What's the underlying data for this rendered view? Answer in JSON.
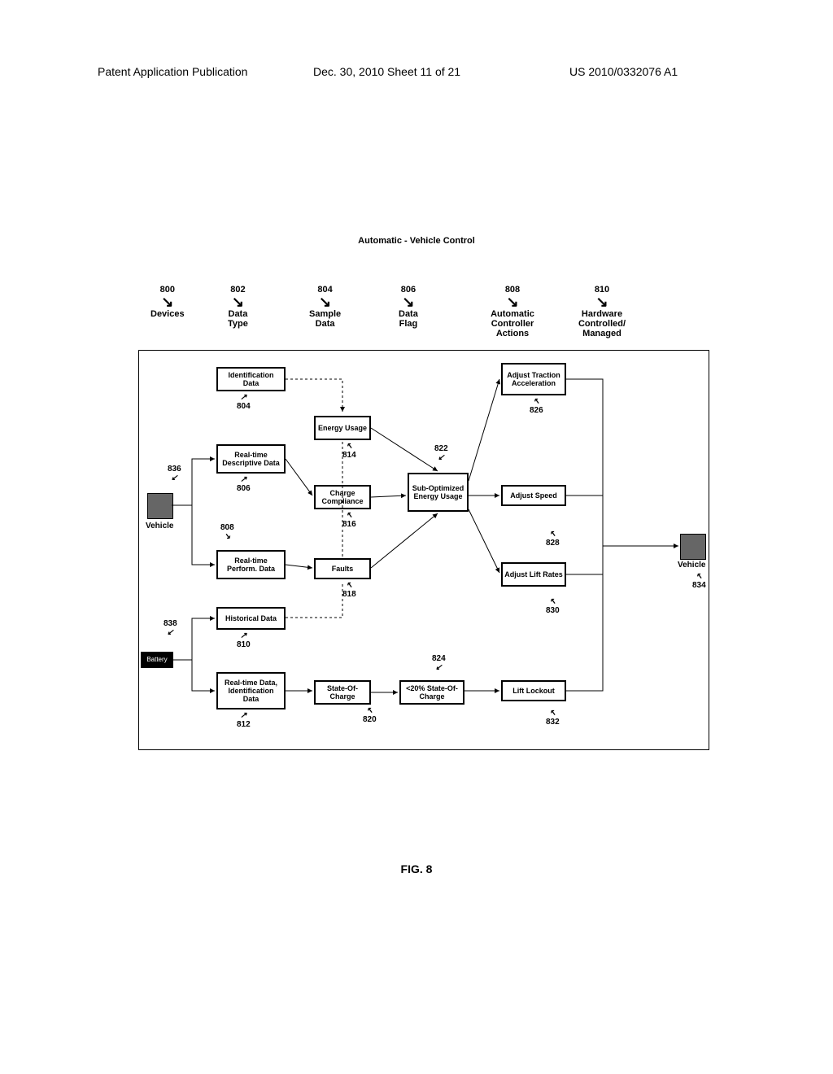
{
  "header": {
    "left": "Patent Application Publication",
    "mid": "Dec. 30, 2010  Sheet 11 of 21",
    "right": "US 2010/0332076 A1"
  },
  "title": "Automatic - Vehicle Control",
  "columns": {
    "c800": {
      "num": "800",
      "label": "Devices"
    },
    "c802": {
      "num": "802",
      "label": "Data Type"
    },
    "c804": {
      "num": "804",
      "label": "Sample Data"
    },
    "c806": {
      "num": "806",
      "label": "Data Flag"
    },
    "c808": {
      "num": "808",
      "label": "Automatic Controller Actions"
    },
    "c810": {
      "num": "810",
      "label": "Hardware Controlled/ Managed"
    }
  },
  "boxes": {
    "identData": "Identification Data",
    "realtimeDesc": "Real-time Descriptive Data",
    "realtimePerf": "Real-time Perform. Data",
    "historical": "Historical Data",
    "realtimeIdent": "Real-time Data, Identification Data",
    "energyUsage": "Energy Usage",
    "chargeCompliance": "Charge Compliance",
    "faults": "Faults",
    "soc": "State-Of-Charge",
    "subOpt": "Sub-Optimized Energy Usage",
    "soc20": "<20% State-Of-Charge",
    "adjTraction": "Adjust Traction Acceleration",
    "adjSpeed": "Adjust Speed",
    "adjLift": "Adjust Lift Rates",
    "liftLockout": "Lift Lockout"
  },
  "labels": {
    "vehicle": "Vehicle",
    "vehicle2": "Vehicle",
    "battery": "Battery",
    "n804": "804",
    "n806": "806",
    "n808": "808",
    "n810": "810",
    "n812": "812",
    "n814": "814",
    "n816": "816",
    "n818": "818",
    "n820": "820",
    "n822": "822",
    "n824": "824",
    "n826": "826",
    "n828": "828",
    "n830": "830",
    "n832": "832",
    "n834": "834",
    "n836": "836",
    "n838": "838"
  },
  "figLabel": "FIG. 8"
}
